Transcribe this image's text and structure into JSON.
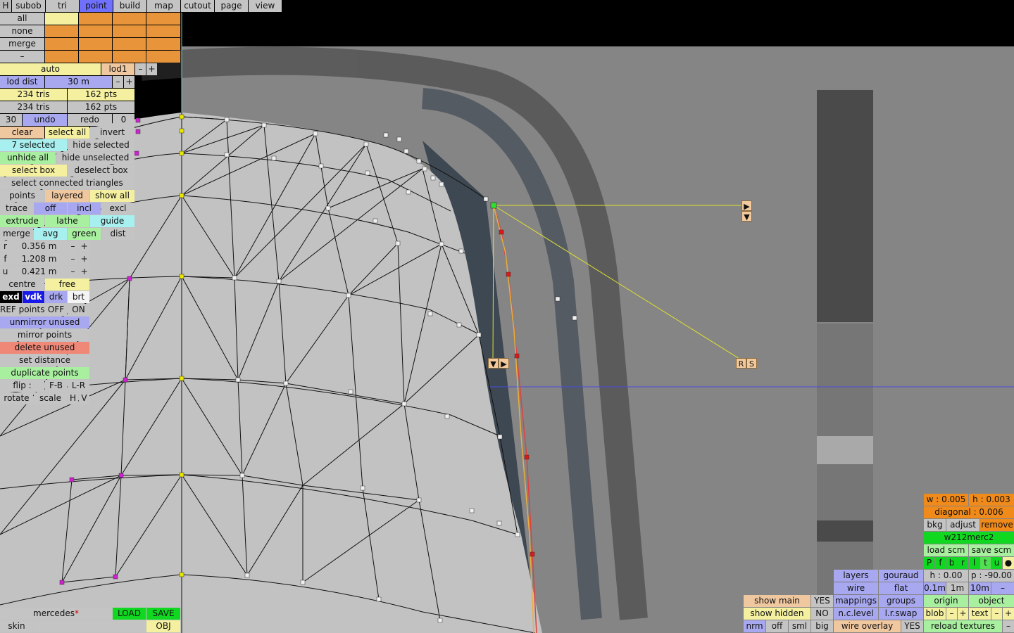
{
  "menu": [
    "H",
    "subob",
    "tri",
    "point",
    "build",
    "map",
    "cutout",
    "page",
    "view"
  ],
  "select_rows": [
    "all",
    "none",
    "merge",
    "–"
  ],
  "lod": {
    "auto": "auto",
    "lod": "lod1",
    "minus": "–",
    "plus": "+",
    "dist_label": "lod dist",
    "dist_value": "30 m"
  },
  "stats": [
    {
      "tris": "234 tris",
      "pts": "162 pts"
    },
    {
      "tris": "234 tris",
      "pts": "162 pts"
    }
  ],
  "undo_row": {
    "count_left": "30",
    "undo": "undo",
    "redo": "redo",
    "count_right": "0"
  },
  "selection": {
    "clear": "clear",
    "select_all": "select all",
    "invert": "invert",
    "selected": "7 selected",
    "hide_selected": "hide selected",
    "unhide_all": "unhide all",
    "hide_unselected": "hide unselected",
    "select_box": "select box",
    "deselect_box": "deselect box",
    "connected": "select connected triangles"
  },
  "points_row": {
    "points": "points",
    "layered": "layered",
    "show_all": "show all"
  },
  "trace_row": {
    "trace": "trace",
    "off": "off",
    "incl": "incl",
    "excl": "excl"
  },
  "extrude_row": {
    "extrude": "extrude",
    "lathe": "lathe",
    "guide": "guide"
  },
  "merge_row": {
    "merge": "merge",
    "avg": "avg",
    "green": "green",
    "dist": "dist"
  },
  "coords": [
    {
      "axis": "r",
      "value": "0.356 m"
    },
    {
      "axis": "f",
      "value": "1.208 m"
    },
    {
      "axis": "u",
      "value": "0.421 m"
    }
  ],
  "pivot": {
    "centre": "centre",
    "free": "free"
  },
  "view_modes": {
    "exd": "exd",
    "vdk": "vdk",
    "drk": "drk",
    "brt": "brt"
  },
  "ref_points": {
    "label": "REF points",
    "off": "OFF",
    "on": "ON"
  },
  "actions": [
    "unmirror unused",
    "mirror points",
    "delete unused",
    "set distance",
    "duplicate points"
  ],
  "flip": {
    "label": "flip :",
    "fb": "F-B",
    "lr": "L-R"
  },
  "transform": {
    "rotate": "rotate",
    "scale": "scale",
    "h": "H",
    "v": "V"
  },
  "file": {
    "name": "mercedes",
    "modified_mark": "*",
    "load": "LOAD",
    "save": "SAVE",
    "skin": "skin",
    "obj": "OBJ"
  },
  "viewport_handles": {
    "arrow_right": "▶",
    "arrow_down": "▼",
    "rs_r": "R",
    "rs_s": "S"
  },
  "right_panel": {
    "w": "w : 0.005",
    "h": "h : 0.003",
    "diagonal": "diagonal : 0.006",
    "bkg": "bkg",
    "adjust": "adjust",
    "remove": "remove",
    "image_name": "w212merc2",
    "load_scm": "load scm",
    "save_scm": "save scm",
    "views": [
      "P",
      "f",
      "b",
      "r",
      "l",
      "t",
      "u",
      "●"
    ],
    "height": "h : 0.00",
    "pitch": "p : -90.00",
    "grid": [
      "0.1m",
      "1m",
      "10m",
      "–"
    ],
    "origin": "origin",
    "object": "object",
    "blob": "blob",
    "text": "text",
    "minus": "–",
    "plus": "+",
    "reload": "reload textures",
    "reload_minus": "–"
  },
  "render_panel": {
    "layers": "layers",
    "gouraud": "gouraud",
    "wire": "wire",
    "flat": "flat",
    "mappings": "mappings",
    "groups": "groups",
    "nclevel": "n.c.level",
    "lrswap": "l.r.swap",
    "wire_overlay": "wire overlay",
    "yes": "YES"
  },
  "show_panel": {
    "show_main": "show main",
    "main_val": "YES",
    "show_hidden": "show hidden",
    "hidden_val": "NO",
    "nrm": "nrm",
    "off": "off",
    "sml": "sml",
    "big": "big"
  },
  "colors": {
    "menu_active": "#7070ff",
    "orange": "#e8943a",
    "yellow": "#f4f0a0",
    "purple": "#a8a8f0",
    "cyan": "#a8f0f0",
    "green": "#a8f0a0",
    "red": "#f08878",
    "bright_green": "#10d820"
  }
}
